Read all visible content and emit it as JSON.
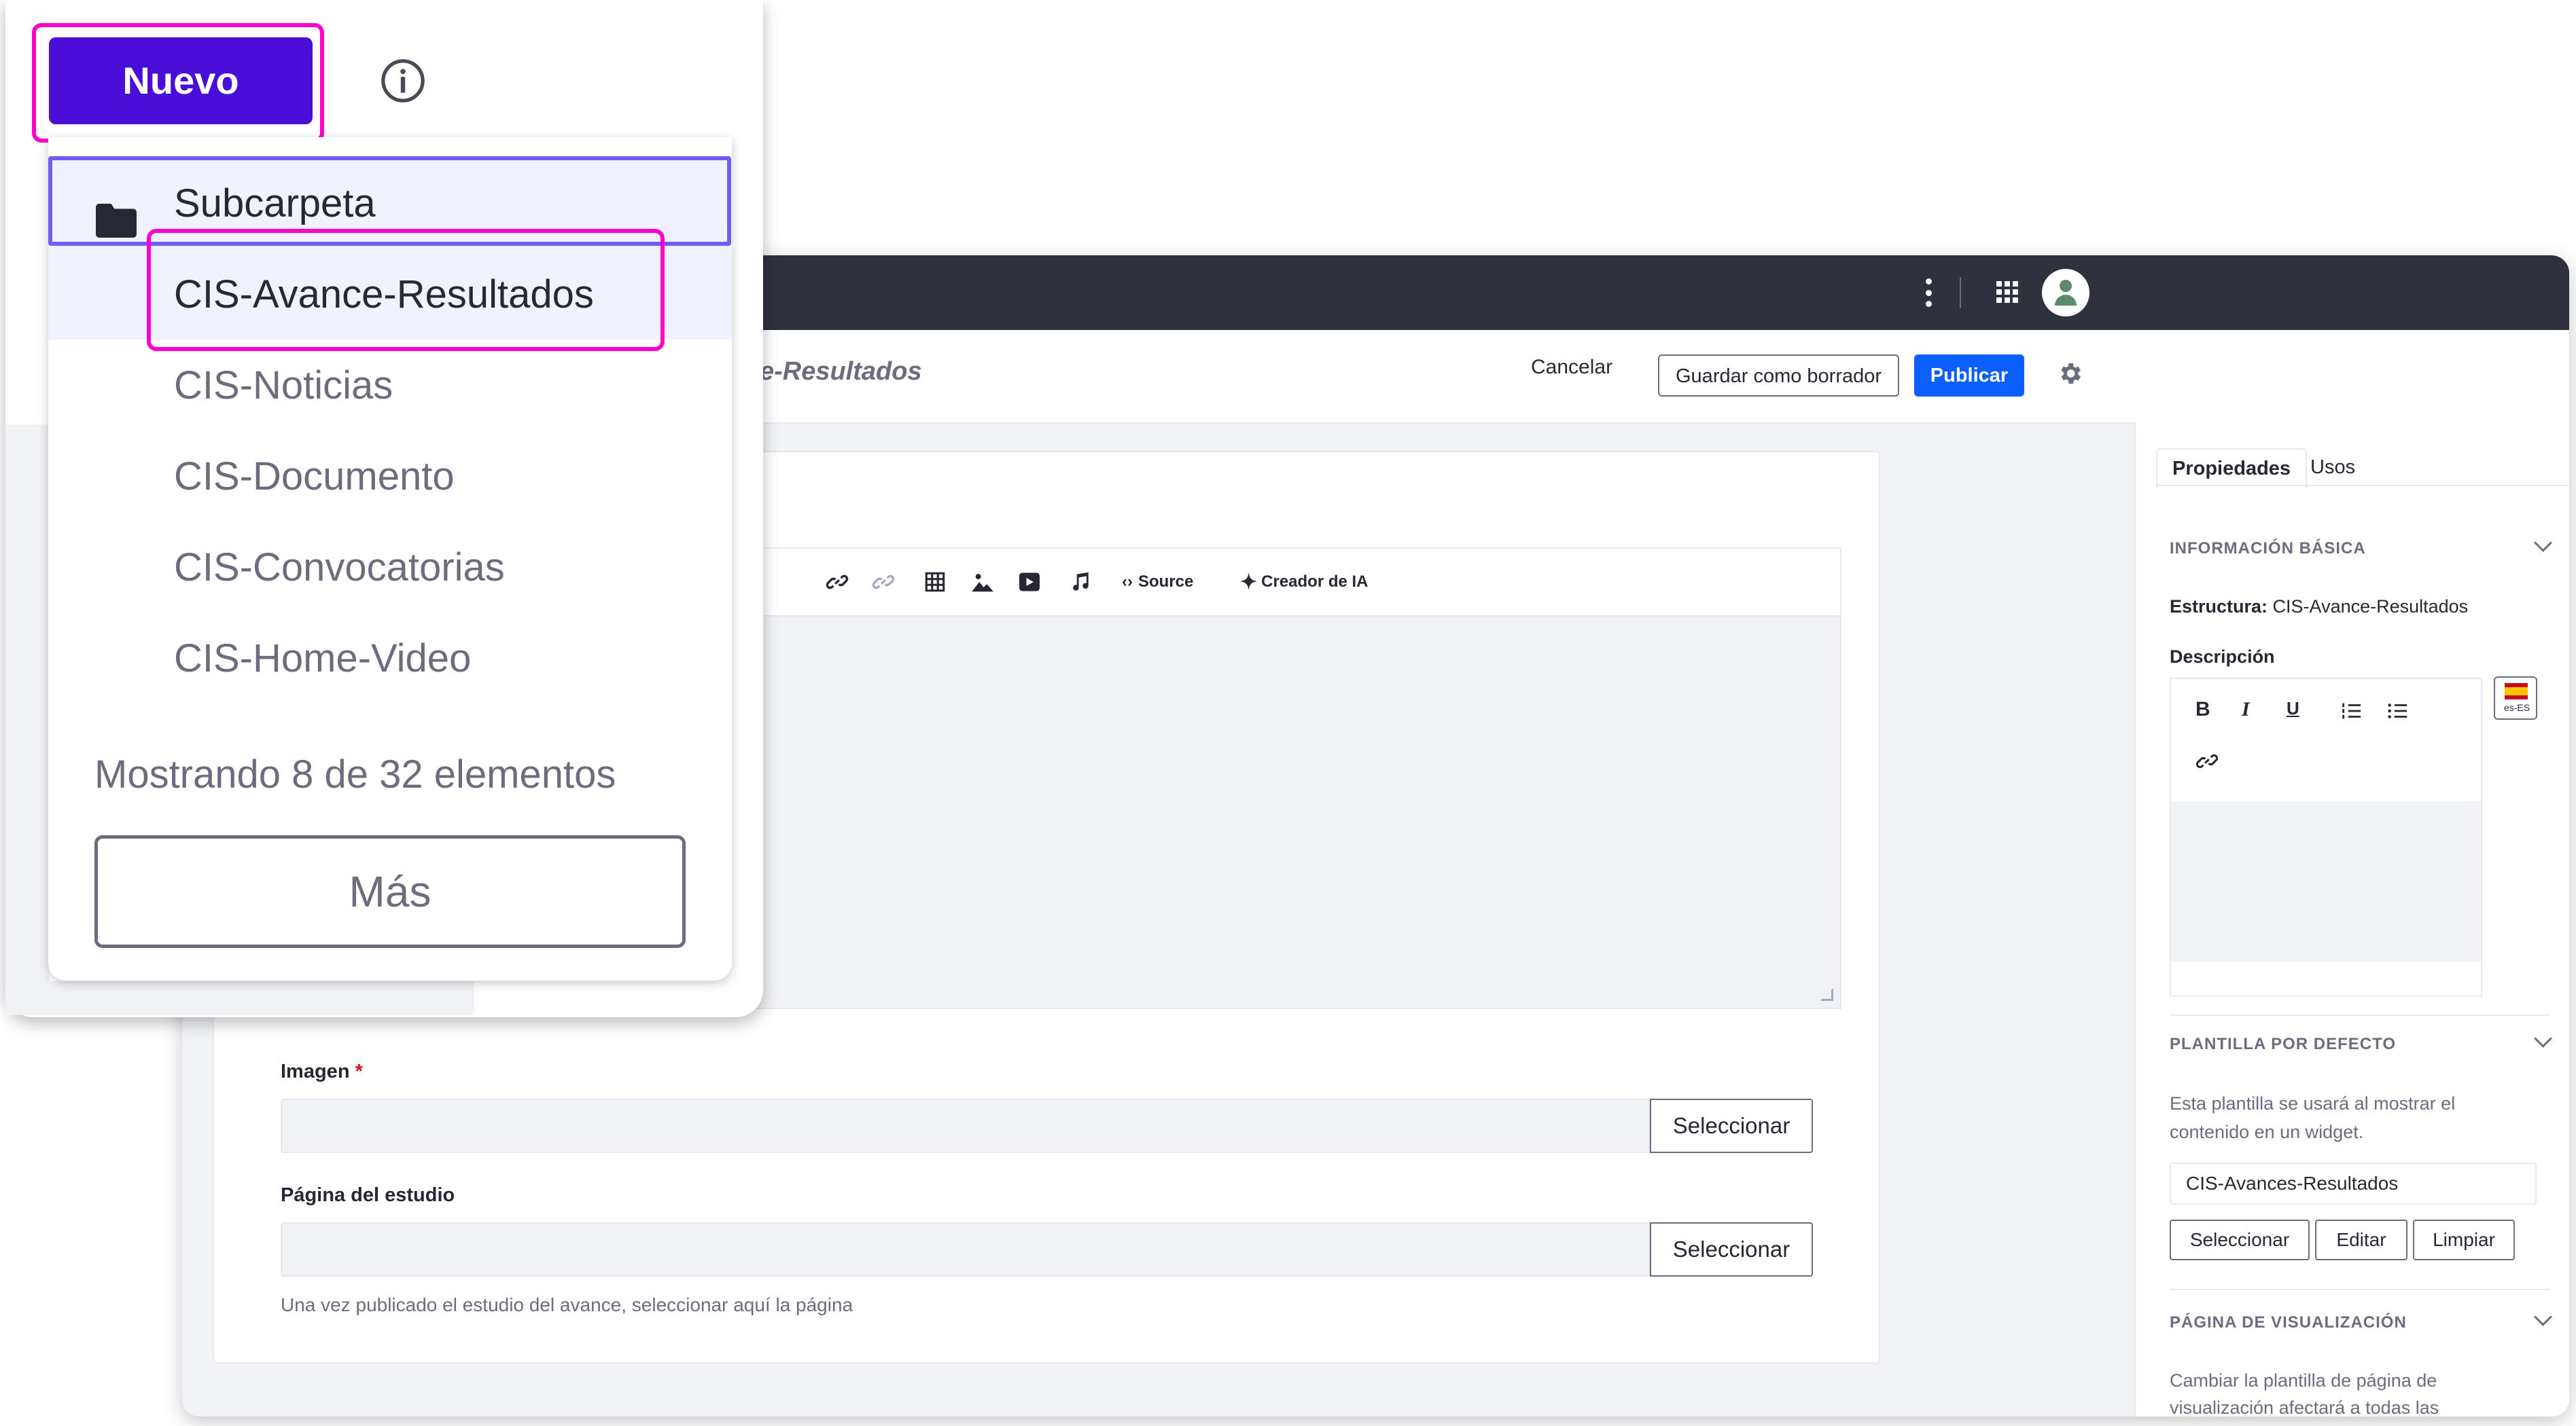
{
  "foreground": {
    "new_button_label": "Nuevo",
    "menu": {
      "items": [
        {
          "label": "Subcarpeta"
        },
        {
          "label": "CIS-Avance-Resultados"
        },
        {
          "label": "CIS-Noticias"
        },
        {
          "label": "CIS-Documento"
        },
        {
          "label": "CIS-Convocatorias"
        },
        {
          "label": "CIS-Home-Video"
        }
      ],
      "showing_text": "Mostrando 8 de 32 elementos",
      "more_label": "Más"
    }
  },
  "editor": {
    "title_partial": "e-Resultados",
    "actions": {
      "cancel": "Cancelar",
      "save_draft": "Guardar como borrador",
      "publish": "Publicar"
    },
    "toolbar": {
      "source": "Source",
      "ai_creator": "Creador de IA"
    },
    "fields": {
      "image_label": "Imagen",
      "required_mark": "*",
      "image_button": "Seleccionar",
      "study_page_label": "Página del estudio",
      "study_page_button": "Seleccionar",
      "study_page_help": "Una vez publicado el estudio del avance, seleccionar aquí la página"
    }
  },
  "right_panel": {
    "tabs": [
      "Propiedades",
      "Usos"
    ],
    "basic_info": {
      "title": "INFORMACIÓN BÁSICA",
      "structure_label": "Estructura:",
      "structure_value": "CIS-Avance-Resultados",
      "description_label": "Descripción",
      "locale": "es-ES"
    },
    "default_template": {
      "title": "PLANTILLA POR DEFECTO",
      "help_line1": "Esta plantilla se usará al mostrar el",
      "help_line2": "contenido en un widget.",
      "value": "CIS-Avances-Resultados",
      "buttons": [
        "Seleccionar",
        "Editar",
        "Limpiar"
      ]
    },
    "display_page": {
      "title": "PÁGINA DE VISUALIZACIÓN",
      "help_line1": "Cambiar la plantilla de página de",
      "help_line2": "visualización afectará a todas las"
    }
  },
  "colors": {
    "primary": "#0b5fff",
    "nuevo": "#4b0ed9",
    "highlight_pink": "#ff00cc",
    "highlight_purple": "#6f5ef0",
    "topbar": "#30313f"
  }
}
